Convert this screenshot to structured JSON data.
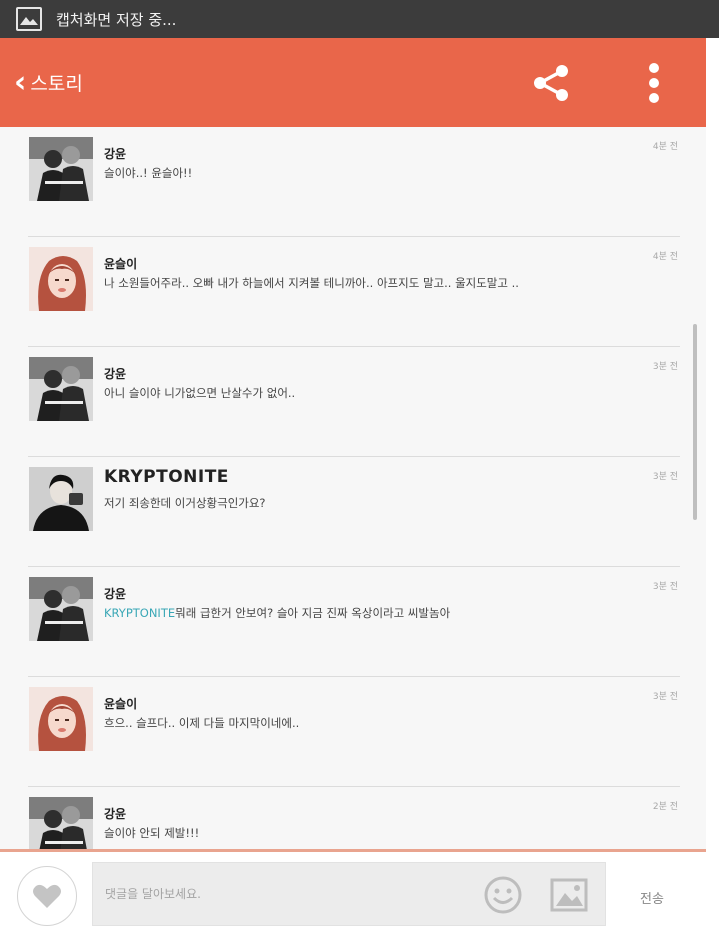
{
  "status_bar": {
    "text": "캡처화면 저장 중..."
  },
  "app_bar": {
    "back_icon": "chevron-left-icon",
    "title": "스토리",
    "share_icon": "share-icon",
    "more_icon": "more-vertical-icon"
  },
  "comments": [
    {
      "author": "강윤",
      "avatar": "couple-photo",
      "mention": "",
      "message": "슬이야..! 윤슬아!!",
      "time": "4분 전"
    },
    {
      "author": "윤슬이",
      "avatar": "girl-photo",
      "mention": "",
      "message": "나 소원들어주라.. 오빠 내가 하늘에서 지켜볼 테니까아.. 아프지도 말고.. 울지도말고 ..",
      "time": "4분 전"
    },
    {
      "author": "강윤",
      "avatar": "couple-photo",
      "mention": "",
      "message": "아니 슬이야 니가없으면 난살수가 없어..",
      "time": "3분 전"
    },
    {
      "author": "KRYPTONITE",
      "avatar": "man-photo",
      "mention": "",
      "message": "저기 죄송한데 이거상황극인가요?",
      "time": "3분 전"
    },
    {
      "author": "강윤",
      "avatar": "couple-photo",
      "mention": "KRYPTONITE",
      "message": "뭐래 급한거 안보여? 슬아 지금 진짜 옥상이라고 씨발놈아",
      "time": "3분 전"
    },
    {
      "author": "윤슬이",
      "avatar": "girl-photo",
      "mention": "",
      "message": "흐으.. 슬프다.. 이제 다들 마지막이네에..",
      "time": "3분 전"
    },
    {
      "author": "강윤",
      "avatar": "couple-photo",
      "mention": "",
      "message": "슬이야 안되 제발!!!",
      "time": "2분 전"
    }
  ],
  "composer": {
    "placeholder": "댓글을 달아보세요.",
    "like_icon": "heart-icon",
    "emoji_icon": "smiley-icon",
    "photo_icon": "image-icon",
    "send_label": "전송"
  },
  "colors": {
    "accent": "#e9664a",
    "status_bar": "#3c3c3c",
    "mention": "#3aa7b6"
  }
}
